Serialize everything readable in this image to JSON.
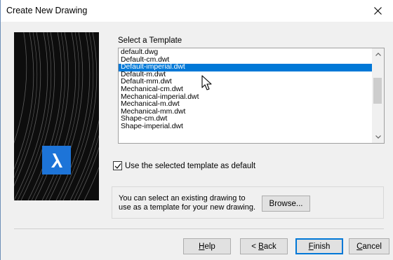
{
  "window": {
    "title": "Create New Drawing"
  },
  "template_group": {
    "label": "Select a Template",
    "items": [
      "default.dwg",
      "Default-cm.dwt",
      "Default-imperial.dwt",
      "Default-m.dwt",
      "Default-mm.dwt",
      "Mechanical-cm.dwt",
      "Mechanical-imperial.dwt",
      "Mechanical-m.dwt",
      "Mechanical-mm.dwt",
      "Shape-cm.dwt",
      "Shape-imperial.dwt"
    ],
    "selected_index": 2
  },
  "default_checkbox": {
    "label": "Use the selected template as default",
    "checked": true
  },
  "info": {
    "text": "You can select an existing drawing to use as a template for your new drawing.",
    "browse_label": "Browse..."
  },
  "buttons": {
    "help_prefix": "",
    "help_mnemonic": "H",
    "help_rest": "elp",
    "back_prefix": "< ",
    "back_mnemonic": "B",
    "back_rest": "ack",
    "finish_mnemonic": "F",
    "finish_rest": "inish",
    "cancel_mnemonic": "C",
    "cancel_rest": "ancel"
  },
  "colors": {
    "selection": "#0078d7",
    "logo_bg": "#1d74d8"
  },
  "icons": {
    "close": "close-icon",
    "logo": "bricscad-logo-icon",
    "check": "checkmark-icon",
    "scroll_up": "chevron-up-icon",
    "scroll_down": "chevron-down-icon",
    "cursor": "mouse-pointer-icon"
  }
}
